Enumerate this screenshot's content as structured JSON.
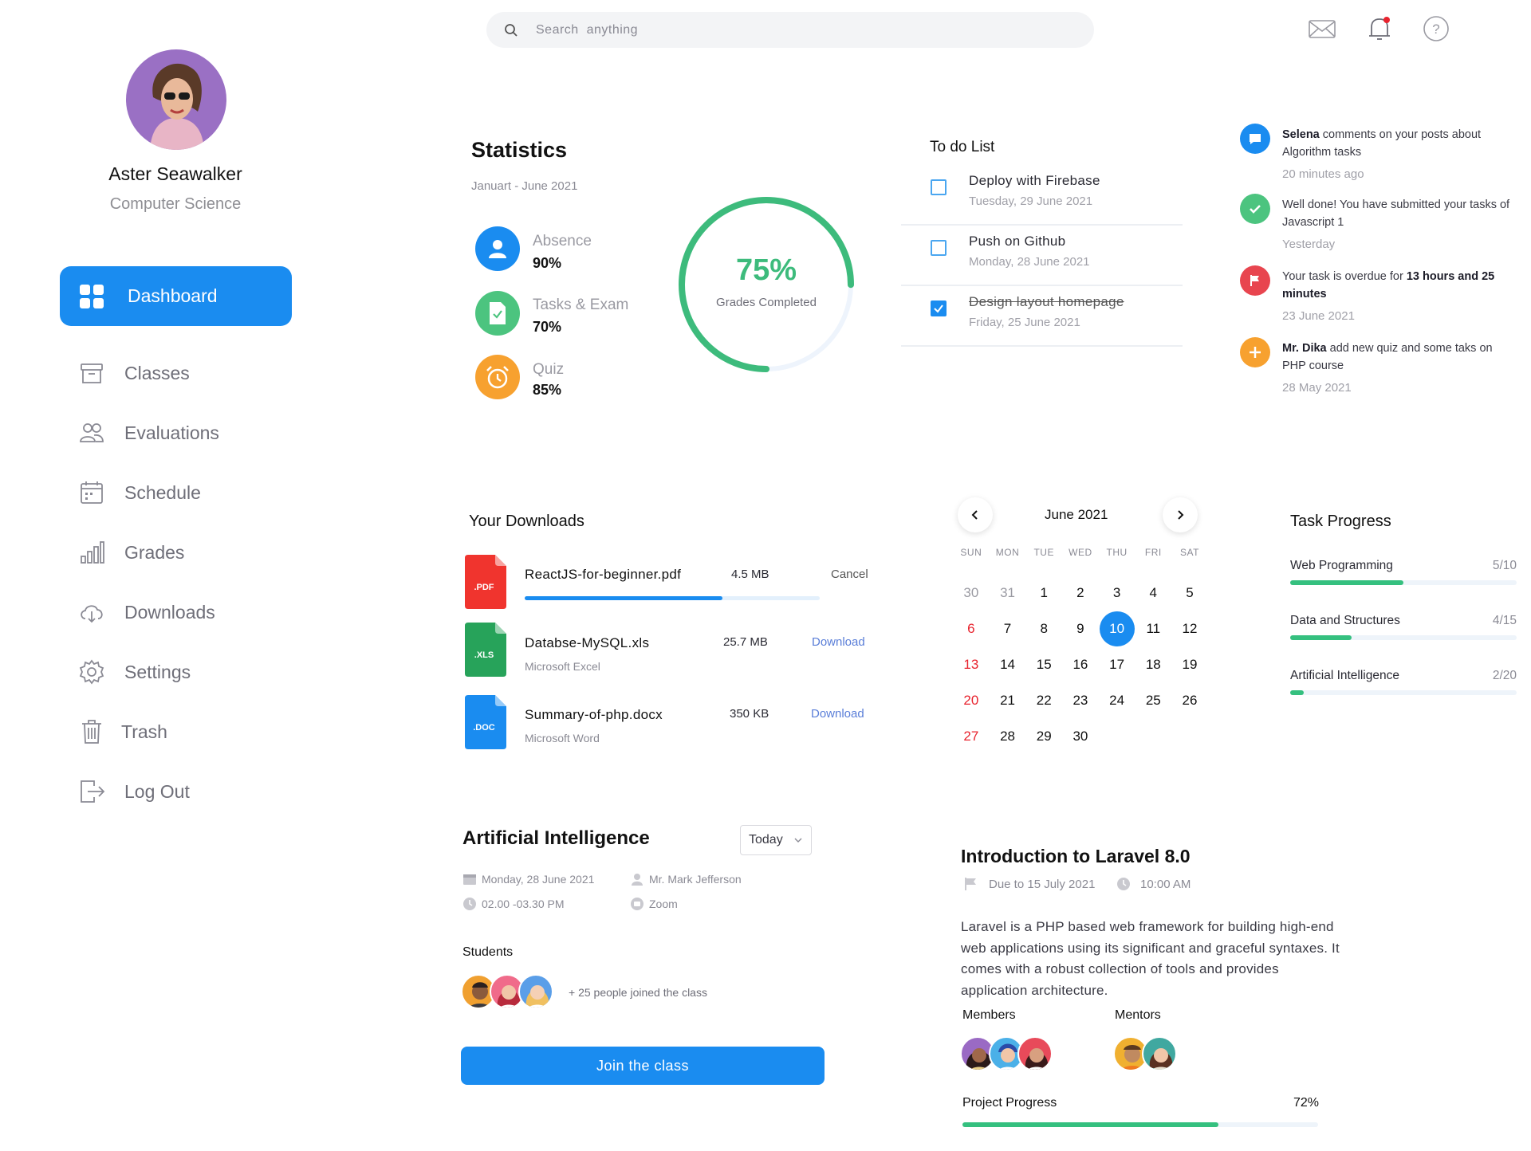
{
  "profile": {
    "name": "Aster Seawalker",
    "department": "Computer Science"
  },
  "nav": {
    "active": "Dashboard",
    "items": [
      "Classes",
      "Evaluations",
      "Schedule",
      "Grades",
      "Downloads",
      "Settings",
      "Trash",
      "Log Out"
    ]
  },
  "search": {
    "placeholder": "Search  anything"
  },
  "header_icons": [
    "mail-icon",
    "bell-icon",
    "help-icon"
  ],
  "statistics": {
    "title": "Statistics",
    "period": "Januart - June 2021",
    "items": [
      {
        "label": "Absence",
        "value": "90%",
        "icon": "user-icon",
        "color": "#1a8cf0"
      },
      {
        "label": "Tasks & Exam",
        "value": "70%",
        "icon": "document-check-icon",
        "color": "#4cc47f"
      },
      {
        "label": "Quiz",
        "value": "85%",
        "icon": "alarm-clock-icon",
        "color": "#f7a12f"
      }
    ],
    "grades": {
      "value": "75%",
      "label": "Grades Completed",
      "fraction": 0.75,
      "color": "#3dbb7c"
    }
  },
  "todo": {
    "title": "To do List",
    "items": [
      {
        "title": "Deploy with Firebase",
        "date": "Tuesday, 29 June 2021",
        "done": false
      },
      {
        "title": "Push on Github",
        "date": "Monday, 28 June 2021",
        "done": false
      },
      {
        "title": "Design layout homepage",
        "date": "Friday, 25 June 2021",
        "done": true
      }
    ]
  },
  "notifications": [
    {
      "icon": "chat-icon",
      "color": "#1a8cf0",
      "bold": "Selena",
      "text": " comments on your posts about Algorithm tasks",
      "time": "20 minutes ago"
    },
    {
      "icon": "check-icon",
      "color": "#4cc47f",
      "text_pre": "Well done! You have submitted your tasks of Javascript 1",
      "time": "Yesterday"
    },
    {
      "icon": "flag-icon",
      "color": "#e8454f",
      "text_pre": "Your task is overdue for ",
      "bold": "13 hours and 25 minutes",
      "time": "23 June 2021"
    },
    {
      "icon": "plus-icon",
      "color": "#f7a12f",
      "bold": "Mr. Dika",
      "text": " add new quiz and some taks on PHP course",
      "time": "28 May 2021"
    }
  ],
  "downloads": {
    "title": "Your Downloads",
    "files": [
      {
        "name": "ReactJS-for-beginner.pdf",
        "type": ".PDF",
        "size": "4.5 MB",
        "action": "Cancel",
        "progress": 0.67,
        "color": "#f0342e"
      },
      {
        "name": "Databse-MySQL.xls",
        "type": ".XLS",
        "app": "Microsoft Excel",
        "size": "25.7 MB",
        "action": "Download",
        "color": "#27a35a"
      },
      {
        "name": "Summary-of-php.docx",
        "type": ".DOC",
        "app": "Microsoft Word",
        "size": "350 KB",
        "action": "Download",
        "color": "#1a8cf0"
      }
    ]
  },
  "calendar": {
    "month": "June 2021",
    "weekdays": [
      "SUN",
      "MON",
      "TUE",
      "WED",
      "THU",
      "FRI",
      "SAT"
    ],
    "leading": [
      "30",
      "31"
    ],
    "days": 30,
    "selected": "10"
  },
  "task_progress": {
    "title": "Task Progress",
    "items": [
      {
        "label": "Web Programming",
        "count": "5/10",
        "fraction": 0.5
      },
      {
        "label": "Data and Structures",
        "count": "4/15",
        "fraction": 0.27
      },
      {
        "label": "Artificial Intelligence",
        "count": "2/20",
        "fraction": 0.06
      }
    ]
  },
  "class_card": {
    "title": "Artificial Intelligence",
    "filter": "Today",
    "date": "Monday, 28 June 2021",
    "time": "02.00 -03.30 PM",
    "teacher": "Mr. Mark Jefferson",
    "platform": "Zoom",
    "students_label": "Students",
    "joined_text": "+ 25 people joined the class",
    "join_button": "Join the class"
  },
  "course_card": {
    "title": "Introduction to Laravel 8.0",
    "due": "Due to 15 July 2021",
    "time": "10:00 AM",
    "description": "Laravel is a PHP based web framework for building high-end web applications using its significant and graceful syntaxes. It comes with a robust collection of tools and provides application architecture.",
    "members_label": "Members",
    "mentors_label": "Mentors",
    "progress_label": "Project Progress",
    "progress_value": "72%",
    "progress_fraction": 0.72
  },
  "colors": {
    "primary": "#1a8cf0",
    "success": "#35c07f",
    "danger": "#e8232e",
    "warning": "#f7a12f"
  }
}
